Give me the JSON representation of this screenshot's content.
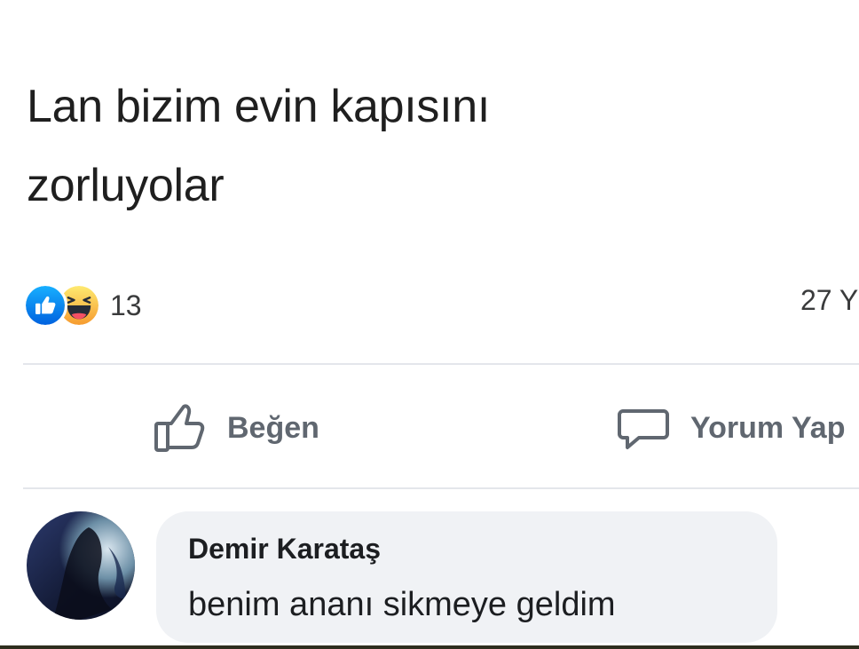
{
  "post": {
    "text_line1": "Lan bizim evin kapısını",
    "text_line2": "zorluyolar"
  },
  "reactions": {
    "icons": [
      "like-reaction-icon",
      "haha-reaction-icon"
    ],
    "count": "13",
    "comments_count_visible": "27 Y"
  },
  "actions": {
    "like_label": "Beğen",
    "comment_label": "Yorum Yap"
  },
  "comment": {
    "author": "Demir Karataş",
    "text": "benim ananı sikmeye geldim"
  },
  "colors": {
    "like_blue": "#1877f2",
    "haha_yellow": "#f7b928",
    "action_gray": "#606770",
    "bubble_bg": "#f0f2f5",
    "divider": "#e4e6eb"
  }
}
